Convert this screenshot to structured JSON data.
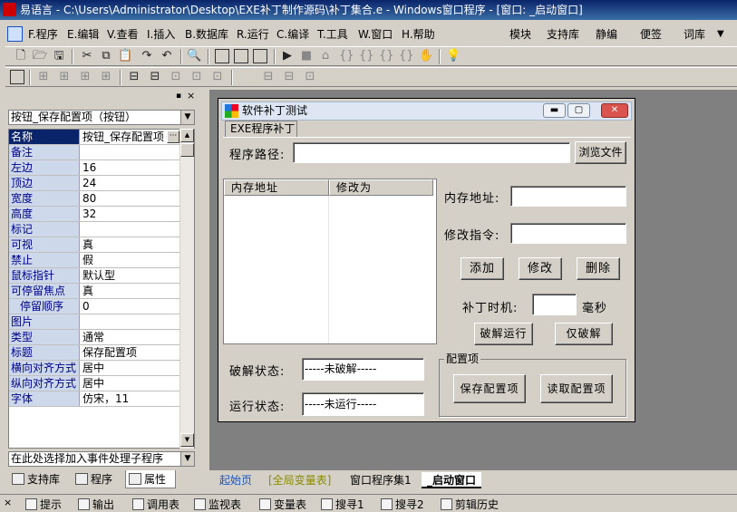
{
  "window": {
    "title": "易语言 - C:\\Users\\Administrator\\Desktop\\EXE补丁制作源码\\补丁集合.e - Windows窗口程序 - [窗口: _启动窗口]"
  },
  "menu": {
    "left": [
      "F.程序",
      "E.编辑",
      "V.查看",
      "I.插入",
      "B.数据库",
      "R.运行",
      "C.编译",
      "T.工具",
      "W.窗口",
      "H.帮助"
    ],
    "right": [
      "模块",
      "支持库",
      "静编",
      "便签",
      "词库"
    ]
  },
  "left_panel": {
    "object_combo": "按钮_保存配置项（按钮）",
    "properties": [
      {
        "name": "名称",
        "value": "按钮_保存配置项"
      },
      {
        "name": "备注",
        "value": ""
      },
      {
        "name": "左边",
        "value": "16"
      },
      {
        "name": "顶边",
        "value": "24"
      },
      {
        "name": "宽度",
        "value": "80"
      },
      {
        "name": "高度",
        "value": "32"
      },
      {
        "name": "标记",
        "value": ""
      },
      {
        "name": "可视",
        "value": "真"
      },
      {
        "name": "禁止",
        "value": "假"
      },
      {
        "name": "鼠标指针",
        "value": "默认型"
      },
      {
        "name": "可停留焦点",
        "value": "真"
      },
      {
        "name": "停留顺序",
        "value": "0"
      },
      {
        "name": "图片",
        "value": ""
      },
      {
        "name": "类型",
        "value": "通常"
      },
      {
        "name": "标题",
        "value": "保存配置项"
      },
      {
        "name": "横向对齐方式",
        "value": "居中"
      },
      {
        "name": "纵向对齐方式",
        "value": "居中"
      },
      {
        "name": "字体",
        "value": "仿宋，11"
      }
    ],
    "event_combo": "在此处选择加入事件处理子程序",
    "tabs": [
      "支持库",
      "程序",
      "属性"
    ]
  },
  "form": {
    "title": "软件补丁测试",
    "tab": "EXE程序补丁",
    "program_path_label": "程序路径:",
    "program_path_value": "",
    "browse_button": "浏览文件",
    "list_columns": [
      "内存地址",
      "修改为"
    ],
    "mem_addr_label": "内存地址:",
    "modify_cmd_label": "修改指令:",
    "add_button": "添加",
    "modify_button": "修改",
    "delete_button": "删除",
    "patch_time_label": "补丁时机:",
    "patch_time_unit": "毫秒",
    "crack_run_button": "破解运行",
    "crack_only_button": "仅破解",
    "crack_status_label": "破解状态:",
    "crack_status_value": "-----未破解-----",
    "run_status_label": "运行状态:",
    "run_status_value": "-----未运行-----",
    "config_group_label": "配置项",
    "save_config_button": "保存配置项",
    "read_config_button": "读取配置项"
  },
  "bottom_tabs": [
    "起始页",
    "[全局变量表]",
    "窗口程序集1",
    "_启动窗口"
  ],
  "bottom_bar": [
    "提示",
    "输出",
    "调用表",
    "监视表",
    "变量表",
    "搜寻1",
    "搜寻2",
    "剪辑历史"
  ]
}
